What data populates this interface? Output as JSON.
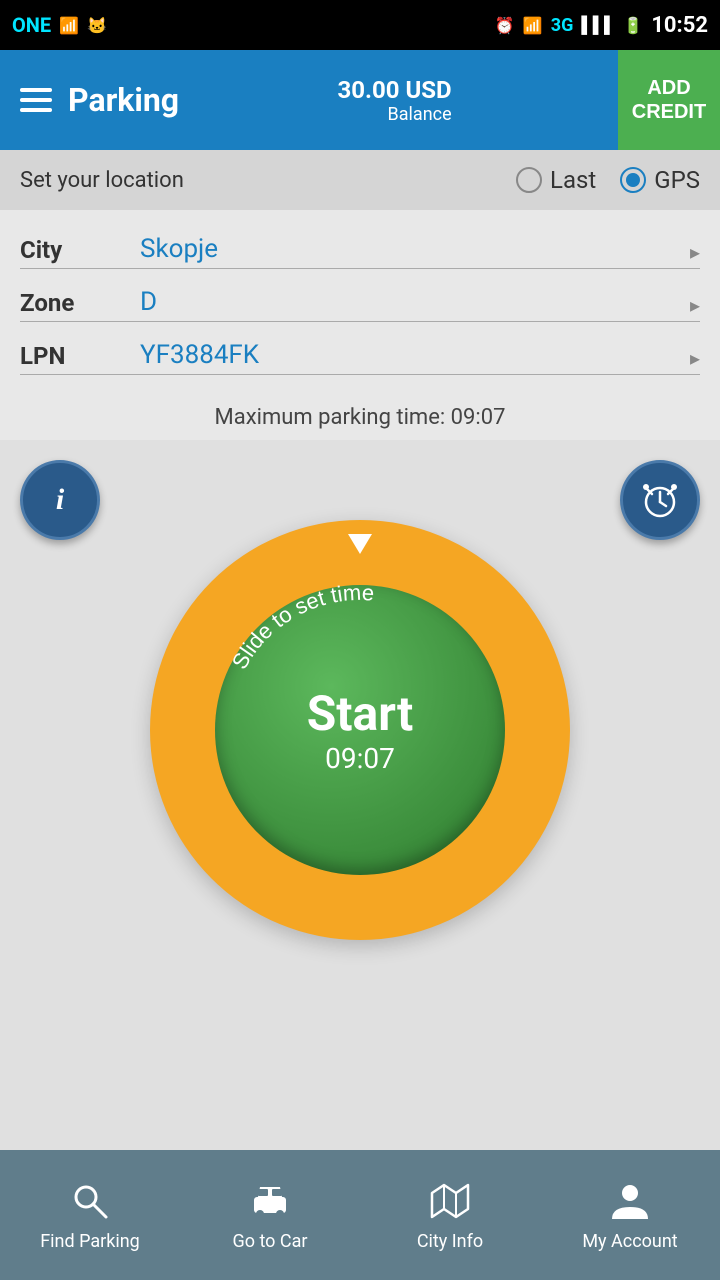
{
  "statusBar": {
    "carrier": "ONE",
    "time": "10:52",
    "network": "3G"
  },
  "header": {
    "title": "Parking",
    "balance_amount": "30.00 USD",
    "balance_label": "Balance",
    "add_credit": "ADD\nCREDIT"
  },
  "locationBar": {
    "label": "Set your location",
    "last_label": "Last",
    "gps_label": "GPS",
    "selected": "GPS"
  },
  "form": {
    "city_label": "City",
    "city_value": "Skopje",
    "zone_label": "Zone",
    "zone_value": "D",
    "lpn_label": "LPN",
    "lpn_value": "YF3884FK"
  },
  "maxTime": {
    "label": "Maximum parking time: 09:07"
  },
  "timer": {
    "start_label": "Start",
    "time_value": "09:07",
    "slide_text": "Slide to set time"
  },
  "bottomNav": {
    "items": [
      {
        "id": "find-parking",
        "label": "Find Parking"
      },
      {
        "id": "go-to-car",
        "label": "Go to Car"
      },
      {
        "id": "city-info",
        "label": "City Info"
      },
      {
        "id": "my-account",
        "label": "My Account"
      }
    ]
  }
}
